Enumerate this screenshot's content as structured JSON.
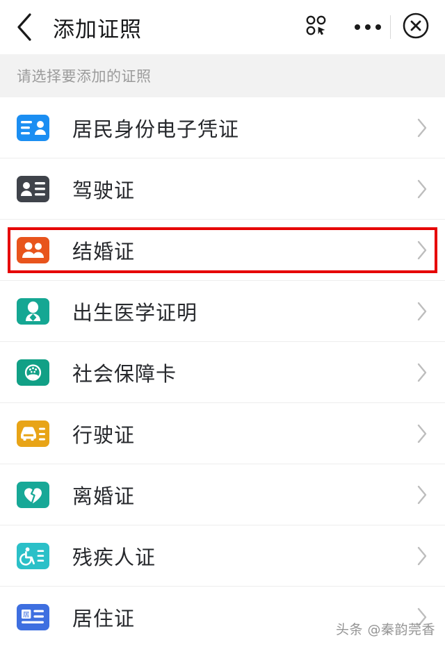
{
  "header": {
    "title": "添加证照",
    "back_icon": "chevron-left-icon",
    "miniprogram_icon": "miniprogram-menu-icon",
    "more_icon": "more-dots-icon",
    "close_icon": "close-circle-icon"
  },
  "section": {
    "label": "请选择要添加的证照"
  },
  "list": {
    "chevron_icon": "chevron-right-icon",
    "items": [
      {
        "label": "居民身份电子凭证",
        "icon": "id-card-icon",
        "icon_bg": "#1b8ef2",
        "highlighted": false
      },
      {
        "label": "驾驶证",
        "icon": "driver-license-card-icon",
        "icon_bg": "#3f434a",
        "highlighted": false
      },
      {
        "label": "结婚证",
        "icon": "couple-icon",
        "icon_bg": "#e8541c",
        "highlighted": true
      },
      {
        "label": "出生医学证明",
        "icon": "baby-icon",
        "icon_bg": "#15a793",
        "highlighted": false
      },
      {
        "label": "社会保障卡",
        "icon": "social-security-emblem-icon",
        "icon_bg": "#11a086",
        "highlighted": false
      },
      {
        "label": "行驶证",
        "icon": "car-card-icon",
        "icon_bg": "#e8a417",
        "highlighted": false
      },
      {
        "label": "离婚证",
        "icon": "broken-heart-icon",
        "icon_bg": "#17a897",
        "highlighted": false
      },
      {
        "label": "残疾人证",
        "icon": "wheelchair-card-icon",
        "icon_bg": "#2bc0c8",
        "highlighted": false
      },
      {
        "label": "居住证",
        "icon": "residence-permit-icon",
        "icon_bg": "#3e6fe0",
        "highlighted": false
      }
    ]
  },
  "watermark": {
    "text": "头条 @秦韵莞香"
  },
  "colors": {
    "highlight_border": "#e60000",
    "band_bg": "#f2f2f2",
    "text_primary": "#26282c",
    "text_muted": "#9b9b9b",
    "chevron": "#bdbdbd"
  }
}
